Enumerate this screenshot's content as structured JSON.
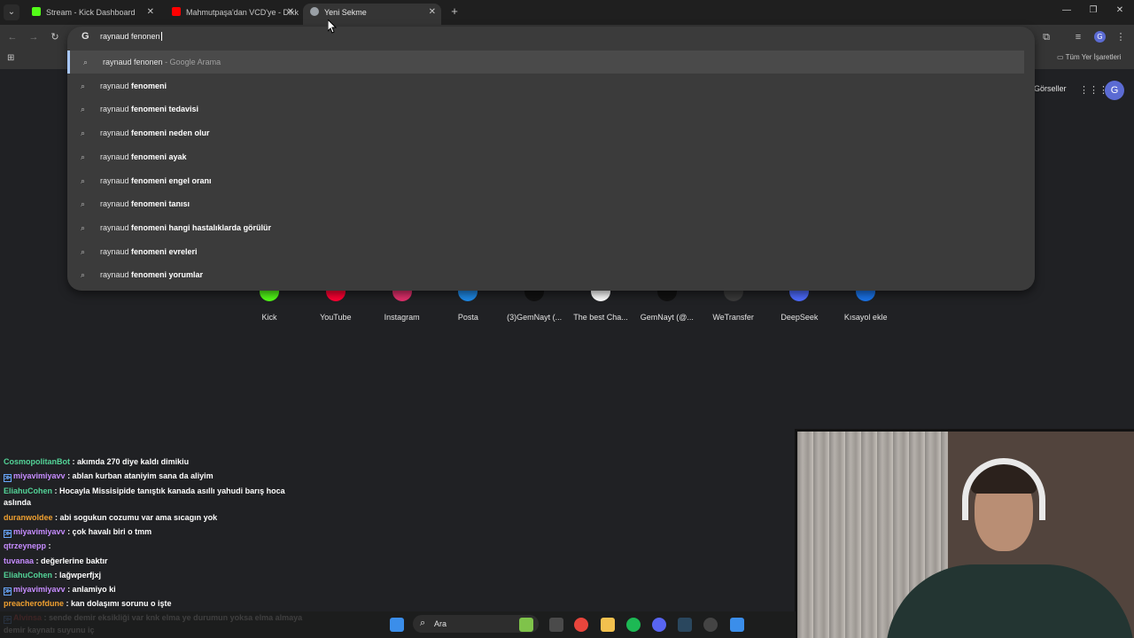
{
  "tabs": [
    {
      "title": "Stream - Kick Dashboard",
      "color": "#53fc18",
      "active": false
    },
    {
      "title": "Mahmutpaşa'dan VCD'ye - Dikk",
      "color": "#ff0000",
      "active": false
    },
    {
      "title": "Yeni Sekme",
      "color": "#9aa0a6",
      "active": true
    }
  ],
  "omnibox": {
    "query": "raynaud fenonen",
    "suggestions": [
      {
        "plain": "raynaud fenonen",
        "bold": "",
        "extra": " - Google Arama",
        "selected": true
      },
      {
        "plain": "raynaud ",
        "bold": "fenomeni",
        "extra": ""
      },
      {
        "plain": "raynaud ",
        "bold": "fenomeni tedavisi",
        "extra": ""
      },
      {
        "plain": "raynaud ",
        "bold": "fenomeni neden olur",
        "extra": ""
      },
      {
        "plain": "raynaud ",
        "bold": "fenomeni ayak",
        "extra": ""
      },
      {
        "plain": "raynaud ",
        "bold": "fenomeni engel oranı",
        "extra": ""
      },
      {
        "plain": "raynaud ",
        "bold": "fenomeni tanısı",
        "extra": ""
      },
      {
        "plain": "raynaud ",
        "bold": "fenomeni hangi hastalıklarda görülür",
        "extra": ""
      },
      {
        "plain": "raynaud ",
        "bold": "fenomeni evreleri",
        "extra": ""
      },
      {
        "plain": "raynaud ",
        "bold": "fenomeni yorumlar",
        "extra": ""
      }
    ]
  },
  "bookmarks": {
    "all_label": "Tüm Yer İşaretleri"
  },
  "ntp": {
    "images_link": "Görseller",
    "avatar_letter": "G",
    "shortcuts": [
      {
        "label": "Kick",
        "color": "#53fc18"
      },
      {
        "label": "YouTube",
        "color": "#ff0033"
      },
      {
        "label": "Instagram",
        "color": "#e1306c"
      },
      {
        "label": "Posta",
        "color": "#1e88e5"
      },
      {
        "label": "(3)GemNayt (...",
        "color": "#111111"
      },
      {
        "label": "The best Cha...",
        "color": "#ffffff"
      },
      {
        "label": "GemNayt (@...",
        "color": "#111111"
      },
      {
        "label": "WeTransfer",
        "color": "#3a3a3a"
      },
      {
        "label": "DeepSeek",
        "color": "#4d6bfe"
      },
      {
        "label": "Kısayol ekle",
        "color": "#1a73e8"
      }
    ]
  },
  "chat": [
    {
      "user": "CosmopolitanBot",
      "color": "#53d397",
      "msg": ": akımda 270 diye kaldı dimikiu",
      "badge": false
    },
    {
      "user": "miyavimiyavv",
      "color": "#c68cff",
      "msg": ": ablan kurban ataniyim sana da aliyim",
      "badge": true
    },
    {
      "user": "EliahuCohen",
      "color": "#53d397",
      "msg": ": Hocayla Missisipide tanıştık kanada asıllı yahudi barış hoca",
      "badge": false
    },
    {
      "user": "",
      "color": "#ffffff",
      "msg": "aslında",
      "badge": false
    },
    {
      "user": "duranwoldee",
      "color": "#f0a030",
      "msg": ": abi sogukun cozumu var ama sıcagın yok",
      "badge": false
    },
    {
      "user": "miyavimiyavv",
      "color": "#c68cff",
      "msg": ": çok havalı biri o tmm",
      "badge": true
    },
    {
      "user": "qtrzeynepp",
      "color": "#c68cff",
      "msg": ":",
      "badge": false
    },
    {
      "user": "tuvanaa",
      "color": "#c68cff",
      "msg": ": değerlerine baktır",
      "badge": false
    },
    {
      "user": "EliahuCohen",
      "color": "#53d397",
      "msg": ": lağwperfjxj",
      "badge": false
    },
    {
      "user": "miyavimiyavv",
      "color": "#c68cff",
      "msg": ": anlamiyo ki",
      "badge": true
    },
    {
      "user": "preacherofdune",
      "color": "#f0a030",
      "msg": ": kan dolaşımı sorunu o işte",
      "badge": false
    },
    {
      "user": "Alvinsa",
      "color": "#ff5555",
      "msg": ": sende demir eksikliği var knk elma ye durumun yoksa elma almaya",
      "badge": true
    },
    {
      "user": "",
      "color": "#ffffff",
      "msg": "demir kaynatı suyunu iç",
      "badge": false
    }
  ],
  "taskbar": {
    "search_placeholder": "Ara"
  }
}
